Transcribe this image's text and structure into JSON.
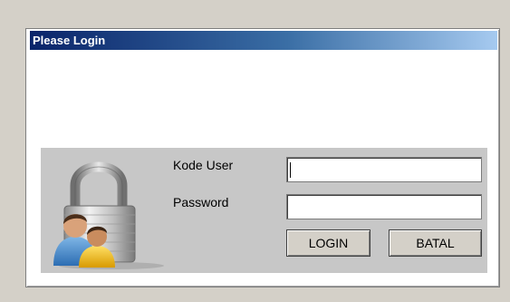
{
  "window": {
    "title": "Please Login"
  },
  "form": {
    "user_label": "Kode User",
    "user_value": "",
    "password_label": "Password",
    "password_value": "",
    "login_label": "LOGIN",
    "cancel_label": "BATAL"
  },
  "icons": {
    "illustration": "lock-users-icon"
  },
  "colors": {
    "titlebar_start": "#0a246a",
    "titlebar_end": "#a6caf0",
    "panel": "#c7c7c7",
    "window_bg": "#d4d0c8"
  }
}
